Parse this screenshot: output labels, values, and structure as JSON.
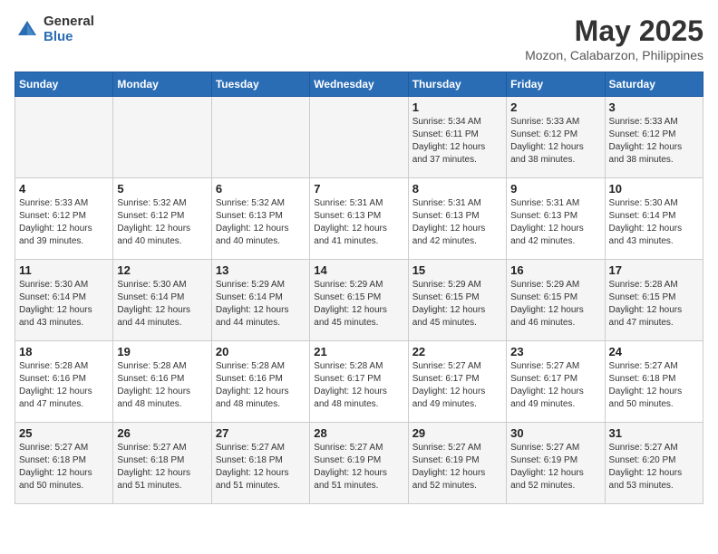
{
  "logo": {
    "general": "General",
    "blue": "Blue"
  },
  "title": "May 2025",
  "subtitle": "Mozon, Calabarzon, Philippines",
  "days_header": [
    "Sunday",
    "Monday",
    "Tuesday",
    "Wednesday",
    "Thursday",
    "Friday",
    "Saturday"
  ],
  "weeks": [
    [
      {
        "day": "",
        "info": ""
      },
      {
        "day": "",
        "info": ""
      },
      {
        "day": "",
        "info": ""
      },
      {
        "day": "",
        "info": ""
      },
      {
        "day": "1",
        "info": "Sunrise: 5:34 AM\nSunset: 6:11 PM\nDaylight: 12 hours\nand 37 minutes."
      },
      {
        "day": "2",
        "info": "Sunrise: 5:33 AM\nSunset: 6:12 PM\nDaylight: 12 hours\nand 38 minutes."
      },
      {
        "day": "3",
        "info": "Sunrise: 5:33 AM\nSunset: 6:12 PM\nDaylight: 12 hours\nand 38 minutes."
      }
    ],
    [
      {
        "day": "4",
        "info": "Sunrise: 5:33 AM\nSunset: 6:12 PM\nDaylight: 12 hours\nand 39 minutes."
      },
      {
        "day": "5",
        "info": "Sunrise: 5:32 AM\nSunset: 6:12 PM\nDaylight: 12 hours\nand 40 minutes."
      },
      {
        "day": "6",
        "info": "Sunrise: 5:32 AM\nSunset: 6:13 PM\nDaylight: 12 hours\nand 40 minutes."
      },
      {
        "day": "7",
        "info": "Sunrise: 5:31 AM\nSunset: 6:13 PM\nDaylight: 12 hours\nand 41 minutes."
      },
      {
        "day": "8",
        "info": "Sunrise: 5:31 AM\nSunset: 6:13 PM\nDaylight: 12 hours\nand 42 minutes."
      },
      {
        "day": "9",
        "info": "Sunrise: 5:31 AM\nSunset: 6:13 PM\nDaylight: 12 hours\nand 42 minutes."
      },
      {
        "day": "10",
        "info": "Sunrise: 5:30 AM\nSunset: 6:14 PM\nDaylight: 12 hours\nand 43 minutes."
      }
    ],
    [
      {
        "day": "11",
        "info": "Sunrise: 5:30 AM\nSunset: 6:14 PM\nDaylight: 12 hours\nand 43 minutes."
      },
      {
        "day": "12",
        "info": "Sunrise: 5:30 AM\nSunset: 6:14 PM\nDaylight: 12 hours\nand 44 minutes."
      },
      {
        "day": "13",
        "info": "Sunrise: 5:29 AM\nSunset: 6:14 PM\nDaylight: 12 hours\nand 44 minutes."
      },
      {
        "day": "14",
        "info": "Sunrise: 5:29 AM\nSunset: 6:15 PM\nDaylight: 12 hours\nand 45 minutes."
      },
      {
        "day": "15",
        "info": "Sunrise: 5:29 AM\nSunset: 6:15 PM\nDaylight: 12 hours\nand 45 minutes."
      },
      {
        "day": "16",
        "info": "Sunrise: 5:29 AM\nSunset: 6:15 PM\nDaylight: 12 hours\nand 46 minutes."
      },
      {
        "day": "17",
        "info": "Sunrise: 5:28 AM\nSunset: 6:15 PM\nDaylight: 12 hours\nand 47 minutes."
      }
    ],
    [
      {
        "day": "18",
        "info": "Sunrise: 5:28 AM\nSunset: 6:16 PM\nDaylight: 12 hours\nand 47 minutes."
      },
      {
        "day": "19",
        "info": "Sunrise: 5:28 AM\nSunset: 6:16 PM\nDaylight: 12 hours\nand 48 minutes."
      },
      {
        "day": "20",
        "info": "Sunrise: 5:28 AM\nSunset: 6:16 PM\nDaylight: 12 hours\nand 48 minutes."
      },
      {
        "day": "21",
        "info": "Sunrise: 5:28 AM\nSunset: 6:17 PM\nDaylight: 12 hours\nand 48 minutes."
      },
      {
        "day": "22",
        "info": "Sunrise: 5:27 AM\nSunset: 6:17 PM\nDaylight: 12 hours\nand 49 minutes."
      },
      {
        "day": "23",
        "info": "Sunrise: 5:27 AM\nSunset: 6:17 PM\nDaylight: 12 hours\nand 49 minutes."
      },
      {
        "day": "24",
        "info": "Sunrise: 5:27 AM\nSunset: 6:18 PM\nDaylight: 12 hours\nand 50 minutes."
      }
    ],
    [
      {
        "day": "25",
        "info": "Sunrise: 5:27 AM\nSunset: 6:18 PM\nDaylight: 12 hours\nand 50 minutes."
      },
      {
        "day": "26",
        "info": "Sunrise: 5:27 AM\nSunset: 6:18 PM\nDaylight: 12 hours\nand 51 minutes."
      },
      {
        "day": "27",
        "info": "Sunrise: 5:27 AM\nSunset: 6:18 PM\nDaylight: 12 hours\nand 51 minutes."
      },
      {
        "day": "28",
        "info": "Sunrise: 5:27 AM\nSunset: 6:19 PM\nDaylight: 12 hours\nand 51 minutes."
      },
      {
        "day": "29",
        "info": "Sunrise: 5:27 AM\nSunset: 6:19 PM\nDaylight: 12 hours\nand 52 minutes."
      },
      {
        "day": "30",
        "info": "Sunrise: 5:27 AM\nSunset: 6:19 PM\nDaylight: 12 hours\nand 52 minutes."
      },
      {
        "day": "31",
        "info": "Sunrise: 5:27 AM\nSunset: 6:20 PM\nDaylight: 12 hours\nand 53 minutes."
      }
    ]
  ]
}
